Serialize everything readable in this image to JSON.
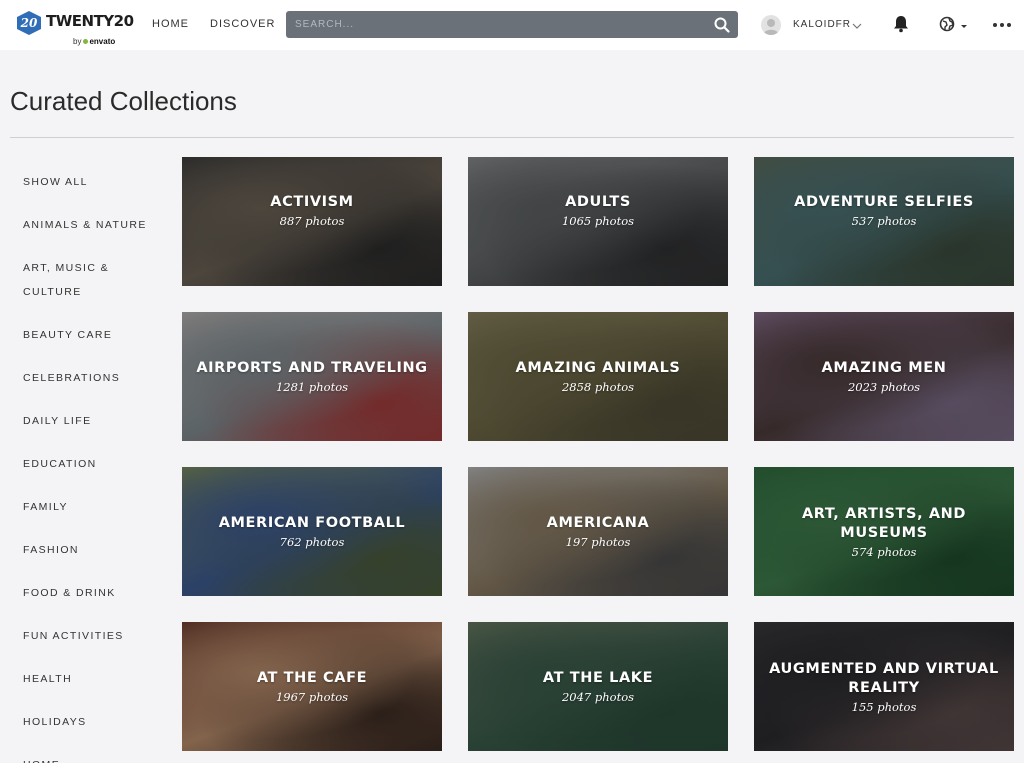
{
  "header": {
    "logo": {
      "badge": "20",
      "word": "TWENTY20",
      "by": "by",
      "brand": "envato"
    },
    "nav": {
      "home": "HOME",
      "discover": "DISCOVER"
    },
    "search": {
      "placeholder": "SEARCH...",
      "value": ""
    },
    "user": {
      "name": "KALOIDFR"
    },
    "icons": [
      "search-icon",
      "user-avatar",
      "chevron-down-icon",
      "bell-icon",
      "globe-icon",
      "caret-down-icon",
      "more-icon"
    ]
  },
  "page": {
    "title": "Curated Collections"
  },
  "sidebar": {
    "items": [
      "SHOW ALL",
      "ANIMALS & NATURE",
      "ART, MUSIC & CULTURE",
      "BEAUTY CARE",
      "CELEBRATIONS",
      "DAILY LIFE",
      "EDUCATION",
      "FAMILY",
      "FASHION",
      "FOOD & DRINK",
      "FUN ACTIVITIES",
      "HEALTH",
      "HOLIDAYS",
      "HOME"
    ]
  },
  "collections": [
    {
      "title": "ACTIVISM",
      "count": "887 photos",
      "colors": [
        "#3a3a3a",
        "#6b6155",
        "#2b2b2b"
      ]
    },
    {
      "title": "ADULTS",
      "count": "1065 photos",
      "colors": [
        "#8a8d8f",
        "#5c5f61",
        "#2e2f30"
      ]
    },
    {
      "title": "ADVENTURE SELFIES",
      "count": "537 photos",
      "colors": [
        "#5c6a5a",
        "#4b6f72",
        "#3a4a3c"
      ]
    },
    {
      "title": "AIRPORTS AND TRAVELING",
      "count": "1281 photos",
      "colors": [
        "#b7b1b0",
        "#7f8a8f",
        "#a13a3a"
      ]
    },
    {
      "title": "AMAZING ANIMALS",
      "count": "2858 photos",
      "colors": [
        "#8b8362",
        "#6b6544",
        "#4e4a36"
      ]
    },
    {
      "title": "AMAZING MEN",
      "count": "2023 photos",
      "colors": [
        "#8a6f8f",
        "#4b3a3a",
        "#7a6b86"
      ]
    },
    {
      "title": "AMERICAN FOOTBALL",
      "count": "762 photos",
      "colors": [
        "#7b8a5a",
        "#3d5a8f",
        "#4b5a3a"
      ]
    },
    {
      "title": "AMERICANA",
      "count": "197 photos",
      "colors": [
        "#b7b9bb",
        "#8a7a62",
        "#4a4a4a"
      ]
    },
    {
      "title": "ART, ARTISTS, AND MUSEUMS",
      "count": "574 photos",
      "colors": [
        "#2f6a3f",
        "#3e7a4b",
        "#1f4a2c"
      ]
    },
    {
      "title": "AT THE CAFE",
      "count": "1967 photos",
      "colors": [
        "#6b3a2e",
        "#b58a6a",
        "#3a2a22"
      ]
    },
    {
      "title": "AT THE LAKE",
      "count": "2047 photos",
      "colors": [
        "#6a7a62",
        "#3a5a4a",
        "#2a4a3a"
      ]
    },
    {
      "title": "AUGMENTED AND VIRTUAL REALITY",
      "count": "155 photos",
      "colors": [
        "#3a3a3e",
        "#2a2a2e",
        "#5a4a4a"
      ]
    }
  ]
}
